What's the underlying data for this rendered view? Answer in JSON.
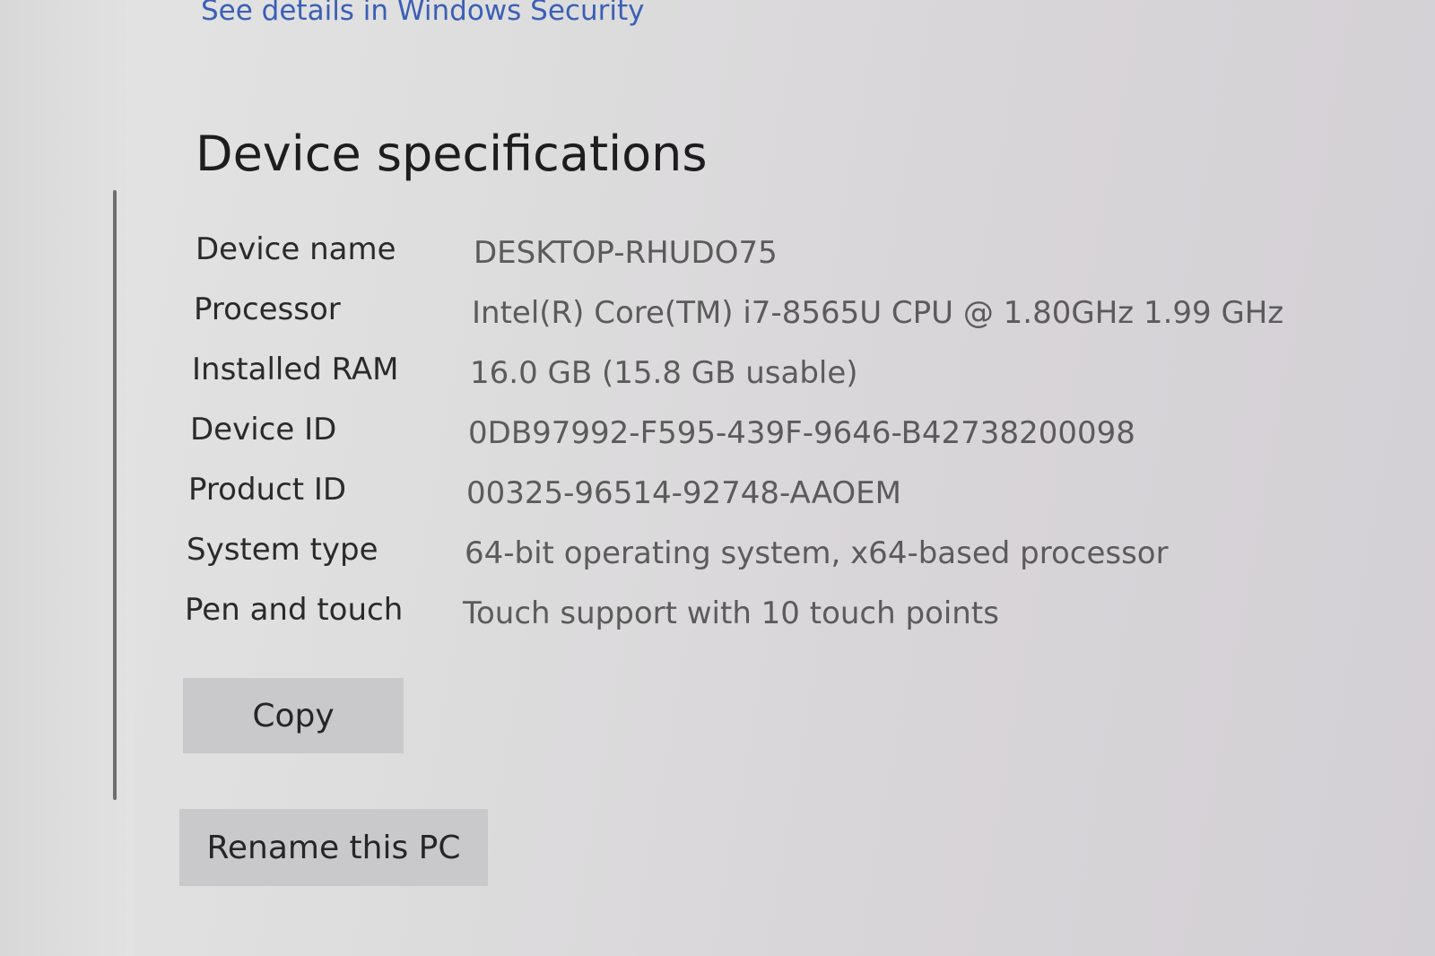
{
  "security_link": "See details in Windows Security",
  "section_title": "Device specifications",
  "specs": [
    {
      "label": "Device name",
      "value": "DESKTOP-RHUDO75"
    },
    {
      "label": "Processor",
      "value": "Intel(R) Core(TM) i7-8565U CPU @ 1.80GHz   1.99 GHz"
    },
    {
      "label": "Installed RAM",
      "value": "16.0 GB (15.8 GB usable)"
    },
    {
      "label": "Device ID",
      "value": "0DB97992-F595-439F-9646-B42738200098"
    },
    {
      "label": "Product ID",
      "value": "00325-96514-92748-AAOEM"
    },
    {
      "label": "System type",
      "value": "64-bit operating system, x64-based processor"
    },
    {
      "label": "Pen and touch",
      "value": "Touch support with 10 touch points"
    }
  ],
  "buttons": {
    "copy": "Copy",
    "rename": "Rename this PC"
  }
}
